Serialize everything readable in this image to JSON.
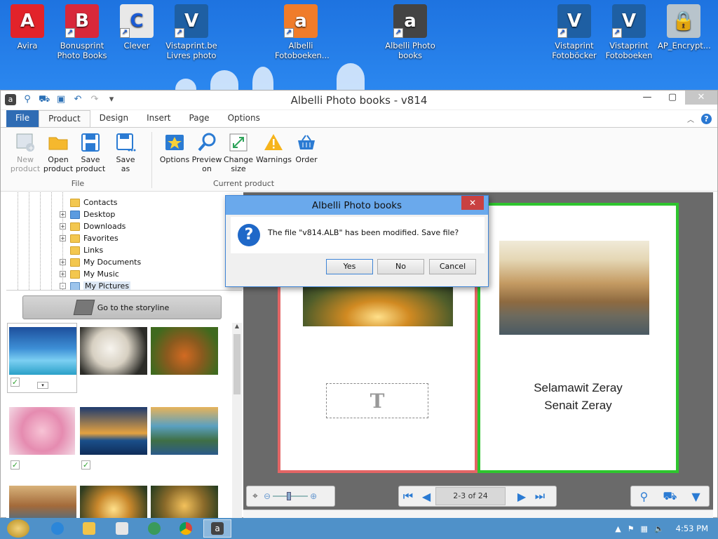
{
  "desktop": {
    "icons": [
      {
        "label": "Avira",
        "color": "#e2232a",
        "glyph": "A"
      },
      {
        "label": "Bonusprint Photo Books",
        "color": "#d8283a",
        "glyph": "B"
      },
      {
        "label": "Clever",
        "color": "#e8e8e8",
        "glyph": "C"
      },
      {
        "label": "Vistaprint.be Livres photo",
        "color": "#1e5fa3",
        "glyph": "V"
      },
      {
        "label": "Albelli Fotoboeken...",
        "color": "#f07c2a",
        "glyph": "a"
      },
      {
        "label": "Albelli Photo books",
        "color": "#444444",
        "glyph": "a"
      },
      {
        "label": "Vistaprint Fotoböcker",
        "color": "#1e5fa3",
        "glyph": "V"
      },
      {
        "label": "Vistaprint Fotoboeken",
        "color": "#1e5fa3",
        "glyph": "V"
      },
      {
        "label": "AP_Encrypt...",
        "color": "#b8c4cc",
        "glyph": "🔒"
      }
    ]
  },
  "window": {
    "title": "Albelli Photo books - v814",
    "qat_icons": [
      "app-icon",
      "search-icon",
      "basket-icon",
      "save-icon",
      "undo-icon",
      "redo-icon",
      "dropdown-icon"
    ]
  },
  "tabs": {
    "file": "File",
    "items": [
      "Product",
      "Design",
      "Insert",
      "Page",
      "Options"
    ],
    "active": "Product"
  },
  "ribbon": {
    "file_group": {
      "label": "File",
      "buttons": [
        {
          "label": "New product",
          "icon": "new-product-icon",
          "disabled": true
        },
        {
          "label": "Open product",
          "icon": "open-folder-icon"
        },
        {
          "label": "Save product",
          "icon": "save-icon"
        },
        {
          "label": "Save as",
          "icon": "save-as-icon"
        }
      ]
    },
    "current_group": {
      "label": "Current product",
      "buttons": [
        {
          "label": "Options",
          "icon": "options-icon"
        },
        {
          "label": "Preview on",
          "icon": "preview-icon"
        },
        {
          "label": "Change size",
          "icon": "change-size-icon"
        },
        {
          "label": "Warnings",
          "icon": "warning-icon"
        },
        {
          "label": "Order",
          "icon": "basket-icon"
        }
      ]
    }
  },
  "tree": {
    "items": [
      {
        "label": "Contacts",
        "expander": ""
      },
      {
        "label": "Desktop",
        "expander": "+"
      },
      {
        "label": "Downloads",
        "expander": "+"
      },
      {
        "label": "Favorites",
        "expander": "+"
      },
      {
        "label": "Links",
        "expander": ""
      },
      {
        "label": "My Documents",
        "expander": "+"
      },
      {
        "label": "My Music",
        "expander": "+"
      },
      {
        "label": "My Pictures",
        "expander": "-"
      }
    ]
  },
  "storyline_button": "Go to the storyline",
  "book": {
    "page_indicator": "2-3 of 24",
    "caption_line1": "Selamawit Zeray",
    "caption_line2": "Senait Zeray",
    "textbox_glyph": "T"
  },
  "dialog": {
    "title": "Albelli Photo books",
    "message": "The file \"v814.ALB\" has been modified. Save file?",
    "yes": "Yes",
    "no": "No",
    "cancel": "Cancel"
  },
  "taskbar": {
    "time": "4:53 PM"
  }
}
